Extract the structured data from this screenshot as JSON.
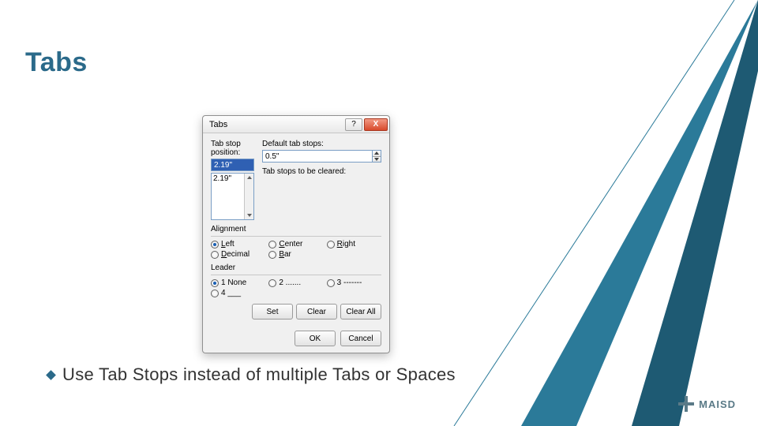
{
  "title": "Tabs",
  "bullet": "Use Tab Stops instead of multiple Tabs or Spaces",
  "logo": "MAISD",
  "dialog": {
    "title": "Tabs",
    "help_btn": "?",
    "close_btn": "X",
    "tab_stop_position_label": "Tab stop position:",
    "tab_stop_value": "2.19\"",
    "list_item": "2.19\"",
    "default_tab_label": "Default tab stops:",
    "default_tab_value": "0.5\"",
    "clear_note_label": "Tab stops to be cleared:",
    "alignment_label": "Alignment",
    "align": {
      "left": "Left",
      "center": "Center",
      "right": "Right",
      "decimal": "Decimal",
      "bar": "Bar"
    },
    "leader_label": "Leader",
    "leader": {
      "none": "1 None",
      "two": "2 .......",
      "three": "3 -------",
      "four": "4 ___"
    },
    "set_btn": "Set",
    "clear_btn": "Clear",
    "clear_all_btn": "Clear All",
    "ok_btn": "OK",
    "cancel_btn": "Cancel"
  }
}
